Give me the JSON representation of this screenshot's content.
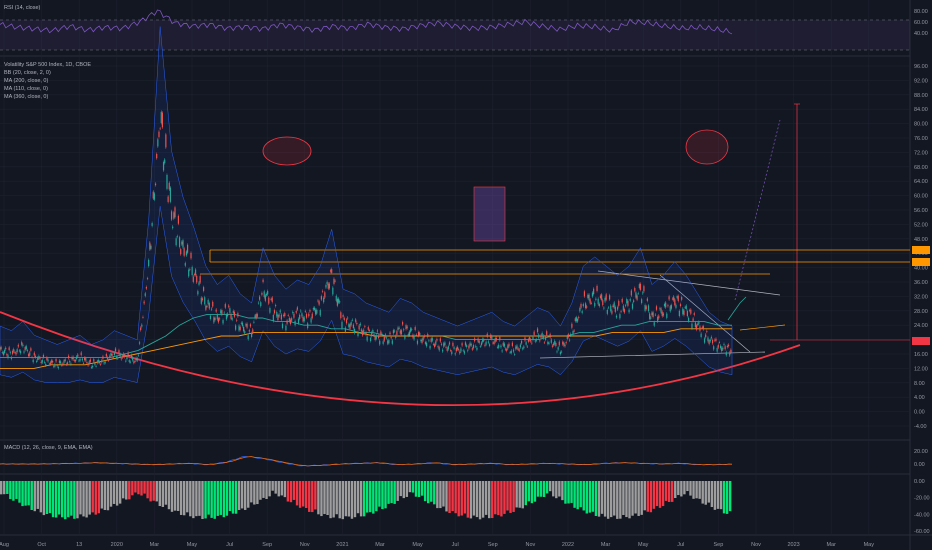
{
  "panes": {
    "rsi": {
      "label": "RSI (14, close)",
      "axis_ticks": [
        "80.00",
        "60.00",
        "40.00"
      ]
    },
    "price": {
      "legend": [
        "Volatility S&P 500 Index, 1D, CBOE",
        "BB (20, close, 2, 0)",
        "MA (200, close, 0)",
        "MA (110, close, 0)",
        "MA (360, close, 0)"
      ],
      "axis_ticks": [
        "96.00",
        "92.00",
        "88.00",
        "84.00",
        "80.00",
        "76.00",
        "72.00",
        "68.00",
        "64.00",
        "60.00",
        "56.00",
        "52.00",
        "48.00",
        "44.00",
        "40.00",
        "36.00",
        "32.00",
        "28.00",
        "24.00",
        "20.00",
        "16.00",
        "12.00",
        "8.00",
        "4.00",
        "0.00",
        "-4.00"
      ],
      "price_badges": [
        "",
        "",
        ""
      ]
    },
    "macd": {
      "label": "MACD (12, 26, close, 9, EMA, EMA)",
      "axis_ticks": [
        "20.00",
        "0.00"
      ]
    },
    "histogram": {
      "axis_ticks": [
        "0.00",
        "-20.00",
        "-40.00",
        "-60.00"
      ]
    }
  },
  "x_axis_labels": [
    "Aug",
    "Oct",
    "13",
    "2020",
    "Mar",
    "May",
    "Jul",
    "Sep",
    "Nov",
    "2021",
    "Mar",
    "May",
    "Jul",
    "Sep",
    "Nov",
    "2022",
    "Mar",
    "May",
    "Jul",
    "Sep",
    "Nov",
    "2023",
    "Mar",
    "May"
  ],
  "chart_data": {
    "type": "line",
    "title": "Volatility S&P 500 Index, 1D, CBOE",
    "xlabel": "",
    "ylabel": "",
    "ylim": [
      -4,
      96
    ],
    "series": [
      {
        "name": "Volatility S&P 500 Index",
        "values": [
          17,
          16,
          18,
          15,
          14,
          13,
          14,
          15,
          13,
          14,
          16,
          15,
          14,
          40,
          82,
          55,
          45,
          38,
          30,
          26,
          28,
          24,
          22,
          34,
          28,
          25,
          27,
          26,
          30,
          38,
          25,
          24,
          22,
          21,
          20,
          23,
          22,
          20,
          19,
          18,
          17,
          18,
          19,
          20,
          18,
          17,
          19,
          21,
          20,
          17,
          22,
          30,
          32,
          30,
          28,
          30,
          34,
          26,
          28,
          31,
          28,
          24,
          20,
          18,
          17
        ]
      },
      {
        "name": "MA (200, close, 0)",
        "values": [
          15,
          15,
          15,
          15,
          15,
          15,
          15,
          15,
          15,
          16,
          17,
          19,
          21,
          24,
          26,
          27,
          27,
          27,
          26,
          26,
          25,
          25,
          24,
          24,
          23,
          23,
          22,
          22,
          21,
          21,
          21,
          21,
          21,
          20,
          20,
          20,
          20,
          20,
          20,
          20,
          21,
          21,
          22,
          22,
          23,
          24,
          24,
          25,
          25,
          25,
          25,
          25,
          24,
          24
        ]
      },
      {
        "name": "MA (360, close, 0)",
        "values": [
          12,
          12,
          12,
          13,
          13,
          13,
          14,
          15,
          16,
          17,
          18,
          19,
          20,
          21,
          21,
          22,
          22,
          22,
          22,
          22,
          22,
          22,
          21,
          21,
          21,
          21,
          21,
          21,
          21,
          21,
          21,
          21,
          21,
          21,
          21,
          21,
          22,
          22,
          22,
          22,
          23,
          23,
          23,
          23
        ]
      }
    ],
    "categories": [
      "Aug",
      "Oct",
      "13",
      "2020",
      "Mar",
      "May",
      "Jul",
      "Sep",
      "Nov",
      "2021",
      "Mar",
      "May",
      "Jul",
      "Sep",
      "Nov",
      "2022",
      "Mar",
      "May",
      "Jul",
      "Sep",
      "Nov",
      "2023",
      "Mar",
      "May"
    ],
    "horizontal_levels": [
      42.7,
      40.7,
      38.6,
      20
    ],
    "rsi": [
      55,
      50,
      47,
      44,
      52,
      45,
      50,
      48,
      60,
      80,
      58,
      52,
      55,
      48,
      51,
      47,
      55,
      50,
      45,
      52,
      48,
      56,
      50,
      47,
      53,
      58,
      52,
      48,
      50,
      55,
      60,
      52,
      46,
      53,
      51,
      44,
      60,
      58,
      52,
      48,
      50,
      46,
      40
    ],
    "macd": [
      0,
      0,
      0,
      0.5,
      1,
      2,
      1,
      0,
      -1,
      0,
      1,
      -1,
      3,
      12,
      8,
      2,
      -3,
      -2,
      0,
      1,
      2,
      -1,
      0,
      2,
      -1,
      0,
      1,
      -1,
      0,
      1,
      0,
      -1,
      1,
      2,
      1,
      0,
      1,
      -1,
      -1,
      0
    ],
    "histogram_style": "green/red/gray bars below zero",
    "grid": true
  }
}
